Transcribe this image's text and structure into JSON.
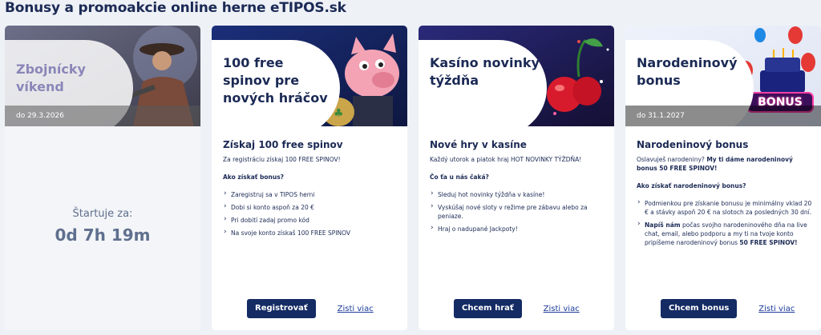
{
  "page": {
    "title": "Bonusy a promoakcie online herne eTIPOS.sk"
  },
  "cards": [
    {
      "banner_title": "Zbojnícky víkend",
      "date": "do 29.3.2026",
      "countdown_label": "Štartuje za:",
      "countdown_value": "0d 7h 19m"
    },
    {
      "banner_title": "100 free spinov pre nových hráčov",
      "date": "",
      "heading": "Získaj 100 free spinov",
      "intro": "Za registráciu získaj 100 FREE SPINOV!",
      "subheading": "Ako získať bonus?",
      "steps": [
        "Zaregistruj sa v TIPOS herni",
        "Dobi si konto aspoň za 20 €",
        "Pri dobití zadaj promo kód",
        "Na svoje konto získaš 100 FREE SPINOV"
      ],
      "button": "Registrovať",
      "more": "Zisti viac"
    },
    {
      "banner_title": "Kasíno novinky týždňa",
      "date": "",
      "heading": "Nové hry v kasíne",
      "intro": "Každý utorok a piatok  hraj HOT NOVINKY TÝŽDŇA!",
      "subheading": "Čo ťa u nás čaká?",
      "steps": [
        "Sleduj hot novinky týždňa v kasíne!",
        "Vyskúšaj nové sloty v režime pre zábavu alebo za peniaze.",
        "Hraj o nadupané Jackpoty!"
      ],
      "button": "Chcem hrať",
      "more": "Zisti viac"
    },
    {
      "banner_title": "Narodeninový bonus",
      "date": "do 31.1.2027",
      "banner_badge": "BONUS",
      "heading": "Narodeninový bonus",
      "intro_plain": "Oslavuješ narodeniny? ",
      "intro_bold": "My ti dáme narodeninový bonus 50 FREE SPINOV!",
      "subheading": "Ako získať narodeninový bonus?",
      "step1": "Podmienkou pre získanie bonusu je minimálny vklad 20 € a stávky aspoň 20 € na slotoch za posledných 30 dní.",
      "step2_bold": "Napíš nám",
      "step2_plain": " počas svojho narodeninového dňa na live chat, email, alebo podporu a my ti na tvoje konto pripíšeme narodeninový bonus ",
      "step2_bold_end": "50 FREE SPINOV!",
      "button": "Chcem bonus",
      "more": "Zisti viac"
    }
  ],
  "colors": {
    "navy": "#142b63",
    "link": "#1b3c9a",
    "page_bg": "#eef1f6"
  }
}
